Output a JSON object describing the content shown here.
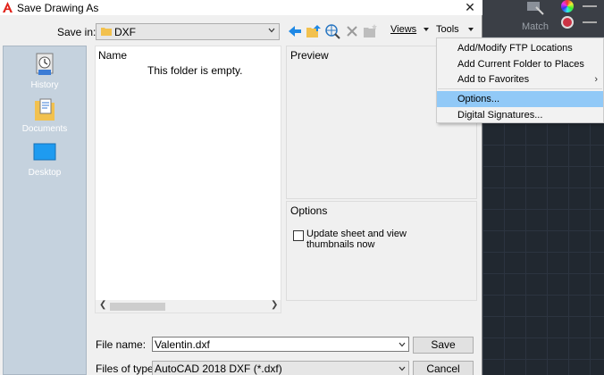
{
  "window": {
    "title": "Save Drawing As",
    "close_label": "✕"
  },
  "save_in": {
    "label": "Save in:",
    "value": "DXF"
  },
  "toolbar": {
    "views_label": "Views",
    "tools_label": "Tools"
  },
  "places": [
    {
      "label": "History",
      "icon": "history-icon"
    },
    {
      "label": "Documents",
      "icon": "documents-icon"
    },
    {
      "label": "Desktop",
      "icon": "desktop-icon"
    }
  ],
  "file_list": {
    "column_header": "Name",
    "empty_message": "This folder is empty."
  },
  "preview": {
    "title": "Preview"
  },
  "options": {
    "title": "Options",
    "checkbox_label": "Update sheet and view thumbnails now",
    "checkbox_checked": false
  },
  "file_name": {
    "label": "File name:",
    "value": "Valentin.dxf"
  },
  "file_type": {
    "label": "Files of type:",
    "value": "AutoCAD 2018 DXF (*.dxf)"
  },
  "buttons": {
    "save": "Save",
    "cancel": "Cancel"
  },
  "tools_menu": [
    {
      "label": "Add/Modify FTP Locations",
      "highlighted": false,
      "submenu": false
    },
    {
      "label": "Add Current Folder to Places",
      "highlighted": false,
      "submenu": false
    },
    {
      "label": "Add to Favorites",
      "highlighted": false,
      "submenu": true
    },
    {
      "label": "Options...",
      "highlighted": true,
      "submenu": false
    },
    {
      "label": "Digital Signatures...",
      "highlighted": false,
      "submenu": false
    }
  ],
  "background_app": {
    "match_label": "Match"
  },
  "colors": {
    "places_bg": "#c5d2de",
    "menu_highlight": "#91c9f7",
    "accent_blue": "#1e88e5",
    "folder_yellow": "#f2c14e"
  }
}
